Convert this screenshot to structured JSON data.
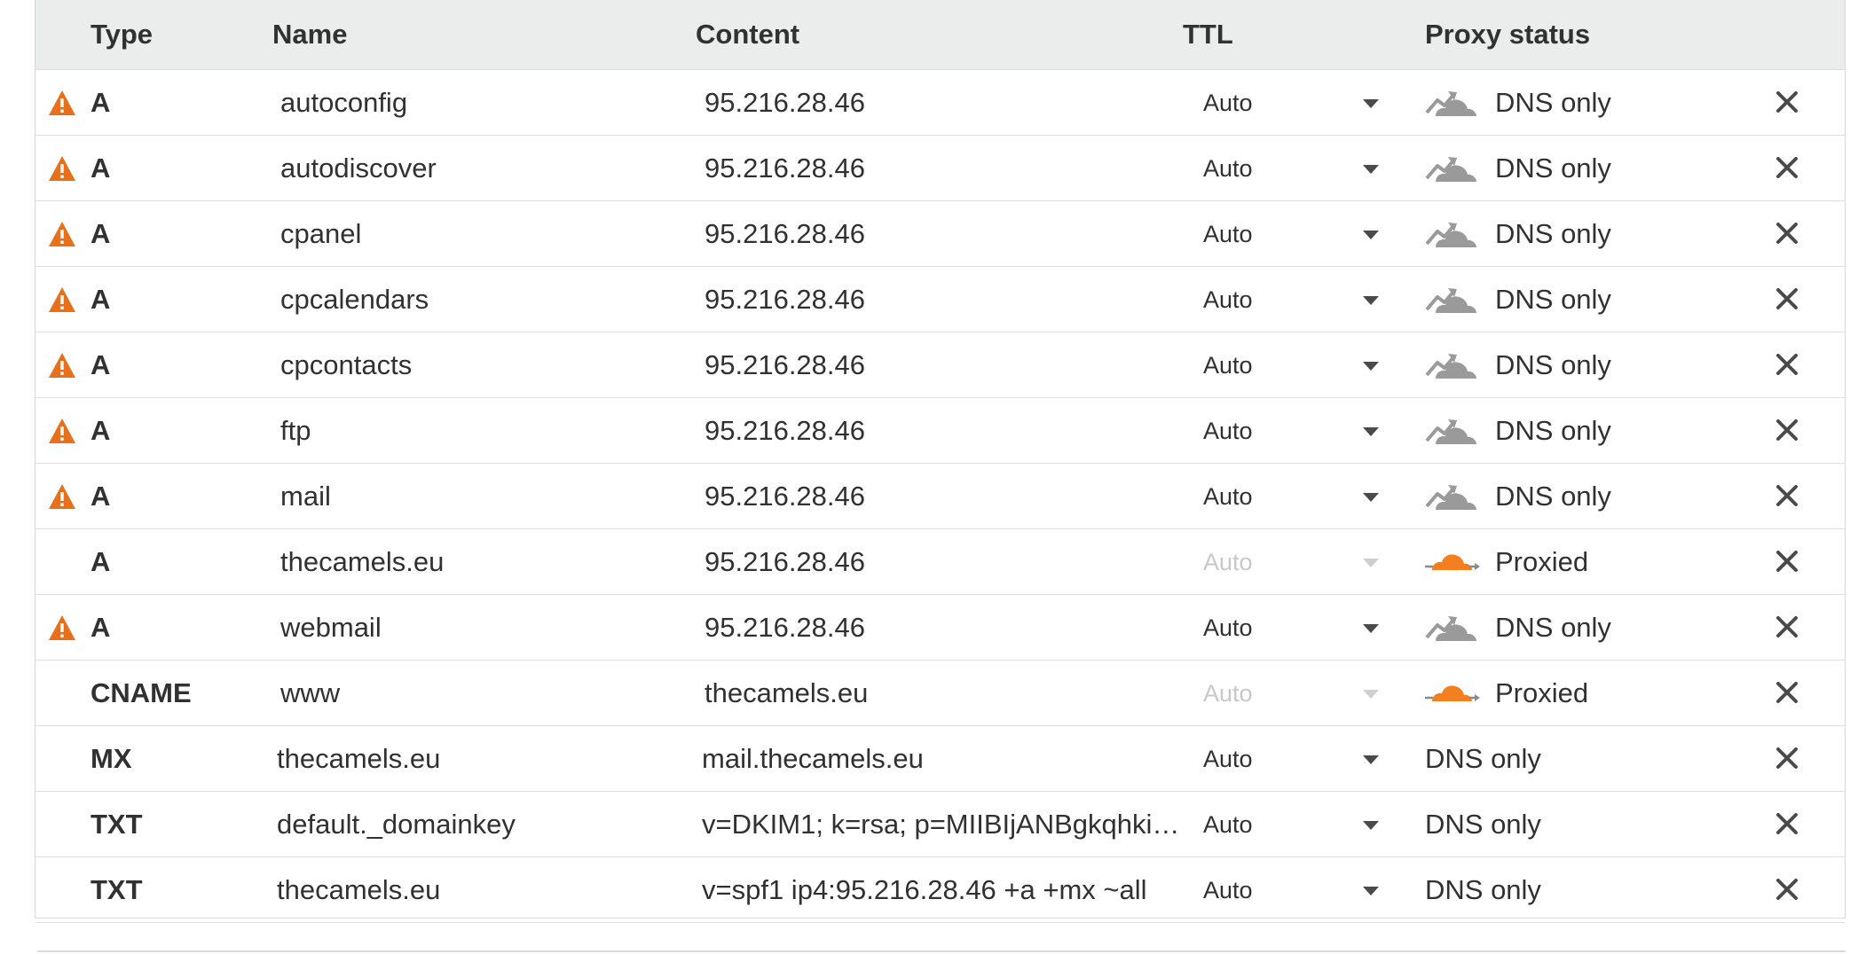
{
  "header": {
    "type": "Type",
    "name": "Name",
    "content": "Content",
    "ttl": "TTL",
    "proxy": "Proxy status"
  },
  "colors": {
    "warning": "#e8701a",
    "proxied_cloud": "#f38020",
    "dns_cloud": "#9a9a9a"
  },
  "rows": [
    {
      "type": "A",
      "name": "autoconfig",
      "content": "95.216.28.46",
      "ttl": "Auto",
      "proxy": "DNS only",
      "cloud": "dns-only-cloud-icon",
      "warning": true,
      "ttl_disabled": false
    },
    {
      "type": "A",
      "name": "autodiscover",
      "content": "95.216.28.46",
      "ttl": "Auto",
      "proxy": "DNS only",
      "cloud": "dns-only-cloud-icon",
      "warning": true,
      "ttl_disabled": false
    },
    {
      "type": "A",
      "name": "cpanel",
      "content": "95.216.28.46",
      "ttl": "Auto",
      "proxy": "DNS only",
      "cloud": "dns-only-cloud-icon",
      "warning": true,
      "ttl_disabled": false
    },
    {
      "type": "A",
      "name": "cpcalendars",
      "content": "95.216.28.46",
      "ttl": "Auto",
      "proxy": "DNS only",
      "cloud": "dns-only-cloud-icon",
      "warning": true,
      "ttl_disabled": false
    },
    {
      "type": "A",
      "name": "cpcontacts",
      "content": "95.216.28.46",
      "ttl": "Auto",
      "proxy": "DNS only",
      "cloud": "dns-only-cloud-icon",
      "warning": true,
      "ttl_disabled": false
    },
    {
      "type": "A",
      "name": "ftp",
      "content": "95.216.28.46",
      "ttl": "Auto",
      "proxy": "DNS only",
      "cloud": "dns-only-cloud-icon",
      "warning": true,
      "ttl_disabled": false
    },
    {
      "type": "A",
      "name": "mail",
      "content": "95.216.28.46",
      "ttl": "Auto",
      "proxy": "DNS only",
      "cloud": "dns-only-cloud-icon",
      "warning": true,
      "ttl_disabled": false
    },
    {
      "type": "A",
      "name": "thecamels.eu",
      "content": "95.216.28.46",
      "ttl": "Auto",
      "proxy": "Proxied",
      "cloud": "proxied-cloud-icon",
      "warning": false,
      "ttl_disabled": true
    },
    {
      "type": "A",
      "name": "webmail",
      "content": "95.216.28.46",
      "ttl": "Auto",
      "proxy": "DNS only",
      "cloud": "dns-only-cloud-icon",
      "warning": true,
      "ttl_disabled": false
    },
    {
      "type": "CNAME",
      "name": "www",
      "content": "thecamels.eu",
      "ttl": "Auto",
      "proxy": "Proxied",
      "cloud": "proxied-cloud-icon",
      "warning": false,
      "ttl_disabled": true
    },
    {
      "type": "MX",
      "name": "thecamels.eu",
      "content": "mail.thecamels.eu",
      "ttl": "Auto",
      "proxy": "DNS only",
      "cloud": "none",
      "warning": false,
      "ttl_disabled": false
    },
    {
      "type": "TXT",
      "name": "default._domainkey",
      "content": "v=DKIM1; k=rsa; p=MIIBIjANBgkqhki…",
      "ttl": "Auto",
      "proxy": "DNS only",
      "cloud": "none",
      "warning": false,
      "ttl_disabled": false
    },
    {
      "type": "TXT",
      "name": "thecamels.eu",
      "content": "v=spf1 ip4:95.216.28.46 +a +mx ~all",
      "ttl": "Auto",
      "proxy": "DNS only",
      "cloud": "none",
      "warning": false,
      "ttl_disabled": false
    }
  ]
}
